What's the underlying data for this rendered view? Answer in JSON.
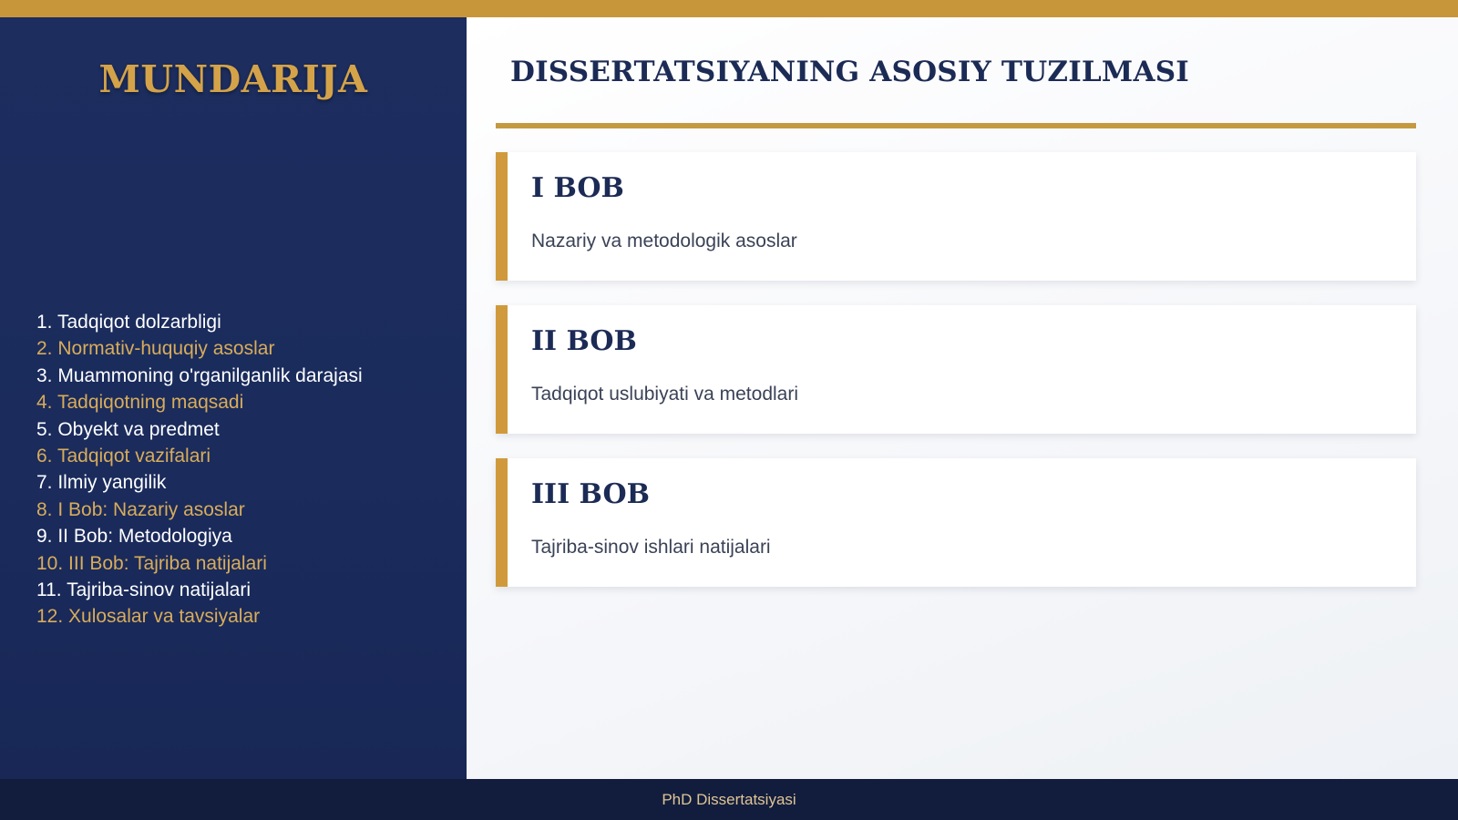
{
  "colors": {
    "accent_gold": "#c8963a",
    "navy": "#1c2d5e",
    "footer_navy": "#121d3d",
    "title_navy": "#1c2b55",
    "toc_accent": "#d8ac5a"
  },
  "sidebar": {
    "title": "MUNDARIJA",
    "items": [
      {
        "label": "1. Tadqiqot dolzarbligi",
        "accent": false
      },
      {
        "label": "2. Normativ-huquqiy asoslar",
        "accent": true
      },
      {
        "label": "3. Muammoning o'rganilganlik darajasi",
        "accent": false
      },
      {
        "label": "4. Tadqiqotning maqsadi",
        "accent": true
      },
      {
        "label": "5. Obyekt va predmet",
        "accent": false
      },
      {
        "label": "6. Tadqiqot vazifalari",
        "accent": true
      },
      {
        "label": "7. Ilmiy yangilik",
        "accent": false
      },
      {
        "label": "8. I Bob: Nazariy asoslar",
        "accent": true
      },
      {
        "label": "9. II Bob: Metodologiya",
        "accent": false
      },
      {
        "label": "10. III Bob: Tajriba natijalari",
        "accent": true
      },
      {
        "label": "11. Tajriba-sinov natijalari",
        "accent": false
      },
      {
        "label": "12. Xulosalar va tavsiyalar",
        "accent": true
      }
    ]
  },
  "main": {
    "title": "DISSERTATSIYANING ASOSIY TUZILMASI",
    "cards": [
      {
        "title": "I BOB",
        "subtitle": "Nazariy va metodologik asoslar"
      },
      {
        "title": "II BOB",
        "subtitle": "Tadqiqot uslubiyati va metodlari"
      },
      {
        "title": "III BOB",
        "subtitle": "Tajriba-sinov ishlari natijalari"
      }
    ]
  },
  "footer": {
    "text": "PhD Dissertatsiyasi"
  }
}
